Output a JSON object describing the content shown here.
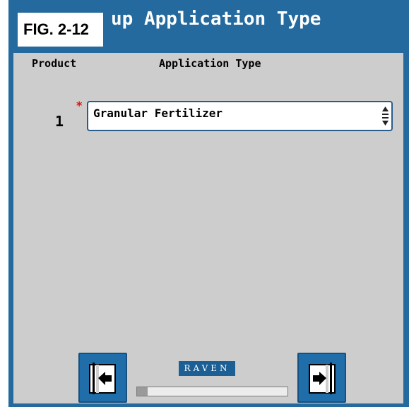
{
  "figure_label": "FIG. 2-12",
  "header": {
    "title": "up Application Type"
  },
  "columns": {
    "product": "Product",
    "application_type": "Application Type"
  },
  "rows": [
    {
      "product_number": "1",
      "required_mark": "*",
      "application_type": "Granular Fertilizer"
    }
  ],
  "footer": {
    "logo_text": "RAVEN",
    "progress_fraction": 0.07
  },
  "icons": {
    "back": "back-arrow-icon",
    "next": "next-arrow-icon",
    "spinner": "up-down-spinner-icon"
  },
  "colors": {
    "header_blue": "#246a9e",
    "panel_gray": "#cdcdcd",
    "button_blue": "#1f6eaa",
    "required_red": "#e01010"
  }
}
